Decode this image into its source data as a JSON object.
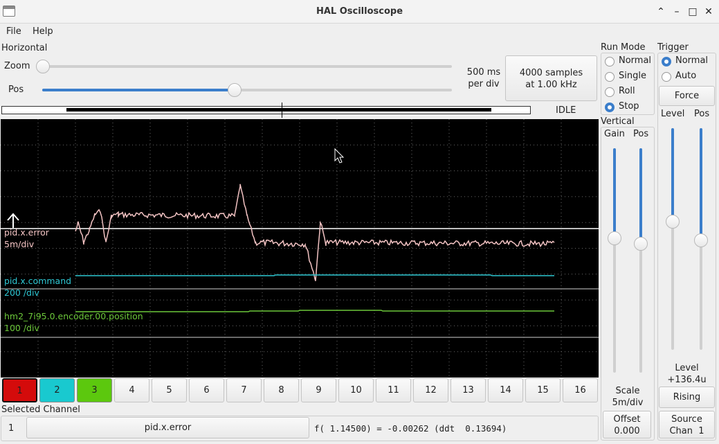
{
  "window": {
    "title": "HAL Oscilloscope",
    "controls": [
      "⌃",
      "–",
      "□",
      "✕"
    ]
  },
  "menu": {
    "file": "File",
    "help": "Help"
  },
  "horizontal": {
    "section": "Horizontal",
    "zoom_label": "Zoom",
    "pos_label": "Pos",
    "zoom_level": 0.0,
    "pos_level": 0.47,
    "rate": "500 ms\nper div",
    "samples": "4000 samples\nat 1.00 kHz",
    "status": "IDLE"
  },
  "run_mode": {
    "title": "Run Mode",
    "options": [
      "Normal",
      "Single",
      "Roll",
      "Stop"
    ],
    "selected": "Stop"
  },
  "trigger": {
    "title": "Trigger",
    "options": [
      "Normal",
      "Auto"
    ],
    "selected": "Normal",
    "force": "Force",
    "level_label": "Level",
    "pos_label": "Pos",
    "level_value_label": "Level",
    "level_value": "+136.4u",
    "edge": "Rising",
    "source": "Source\nChan  1"
  },
  "vertical": {
    "title": "Vertical",
    "gain_label": "Gain",
    "pos_label": "Pos",
    "scale_label": "Scale",
    "scale_value": "5m/div",
    "offset_label": "Offset",
    "offset_value": "0.000"
  },
  "traces": [
    {
      "name": "pid.x.error",
      "scale": "5m/div",
      "color": "#f4c4c4"
    },
    {
      "name": "pid.x.command",
      "scale": "200 /div",
      "color": "#2ec7d3"
    },
    {
      "name": "hm2_7i95.0.encoder.00.position",
      "scale": "100 /div",
      "color": "#6cc83a"
    }
  ],
  "channels": [
    "1",
    "2",
    "3",
    "4",
    "5",
    "6",
    "7",
    "8",
    "9",
    "10",
    "11",
    "12",
    "13",
    "14",
    "15",
    "16"
  ],
  "channel_colors": {
    "1": "#d40b0b",
    "2": "#19c9cf",
    "3": "#5cc80e"
  },
  "selected_channel": {
    "label": "Selected Channel",
    "number": "1",
    "name": "pid.x.error",
    "readout": "f( 1.14500) = -0.00262 (ddt  0.13694)"
  }
}
